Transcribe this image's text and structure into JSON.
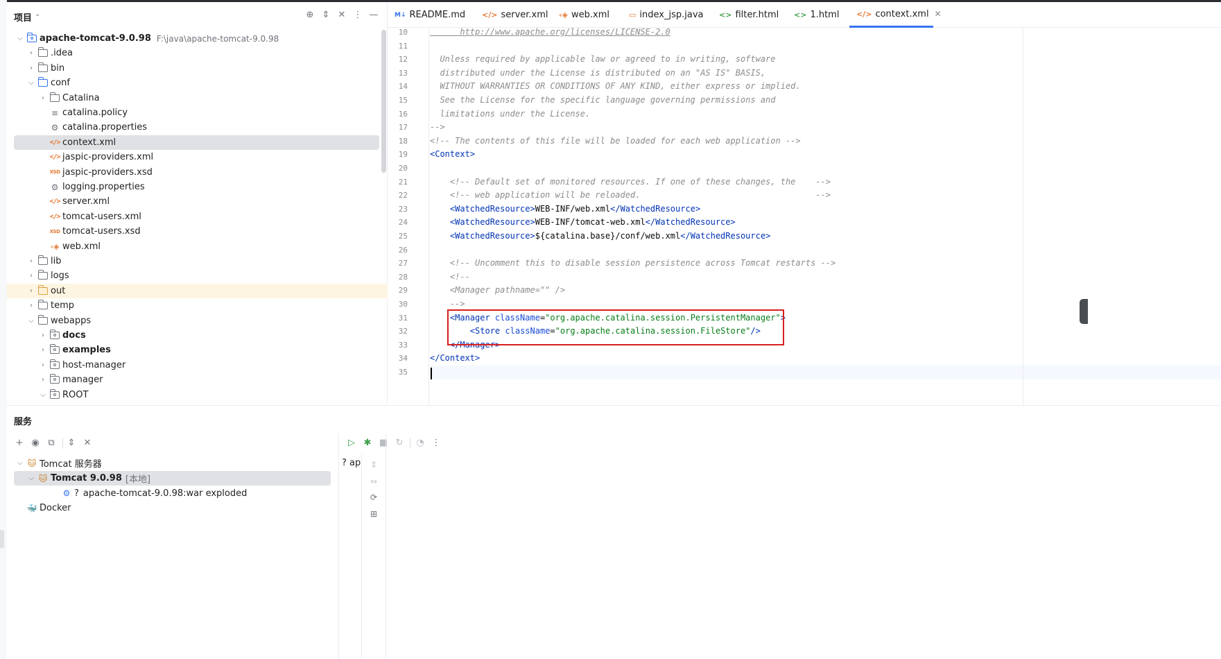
{
  "project": {
    "title": "项目",
    "tree": [
      {
        "label": "apache-tomcat-9.0.98",
        "path": "F:\\java\\apache-tomcat-9.0.98"
      },
      {
        "label": ".idea"
      },
      {
        "label": "bin"
      },
      {
        "label": "conf"
      },
      {
        "label": "Catalina"
      },
      {
        "label": "catalina.policy"
      },
      {
        "label": "catalina.properties"
      },
      {
        "label": "context.xml"
      },
      {
        "label": "jaspic-providers.xml"
      },
      {
        "label": "jaspic-providers.xsd"
      },
      {
        "label": "logging.properties"
      },
      {
        "label": "server.xml"
      },
      {
        "label": "tomcat-users.xml"
      },
      {
        "label": "tomcat-users.xsd"
      },
      {
        "label": "web.xml"
      },
      {
        "label": "lib"
      },
      {
        "label": "logs"
      },
      {
        "label": "out"
      },
      {
        "label": "temp"
      },
      {
        "label": "webapps"
      },
      {
        "label": "docs"
      },
      {
        "label": "examples"
      },
      {
        "label": "host-manager"
      },
      {
        "label": "manager"
      },
      {
        "label": "ROOT"
      }
    ]
  },
  "tabs": [
    {
      "label": "README.md",
      "icon": "M↓"
    },
    {
      "label": "server.xml",
      "icon": "</>"
    },
    {
      "label": "web.xml",
      "icon": "</>"
    },
    {
      "label": "index_jsp.java",
      "icon": "▭"
    },
    {
      "label": "filter.html",
      "icon": "<>"
    },
    {
      "label": "1.html",
      "icon": "<>"
    },
    {
      "label": "context.xml",
      "icon": "</>",
      "active": true
    }
  ],
  "editor": {
    "lines": [
      {
        "n": "10",
        "parts": [
          {
            "t": "      http://www.apache.org/licenses/LICENSE-2.0",
            "c": "cm link"
          }
        ]
      },
      {
        "n": "11",
        "parts": []
      },
      {
        "n": "12",
        "parts": [
          {
            "t": "  Unless required by applicable law or agreed to in writing, software",
            "c": "cm"
          }
        ]
      },
      {
        "n": "13",
        "parts": [
          {
            "t": "  distributed under the License is distributed on an \"AS IS\" BASIS,",
            "c": "cm"
          }
        ]
      },
      {
        "n": "14",
        "parts": [
          {
            "t": "  WITHOUT WARRANTIES OR CONDITIONS OF ANY KIND, either express or implied.",
            "c": "cm"
          }
        ]
      },
      {
        "n": "15",
        "parts": [
          {
            "t": "  See the License for the specific language governing permissions and",
            "c": "cm"
          }
        ]
      },
      {
        "n": "16",
        "parts": [
          {
            "t": "  limitations under the License.",
            "c": "cm"
          }
        ]
      },
      {
        "n": "17",
        "parts": [
          {
            "t": "-->",
            "c": "cm"
          }
        ]
      },
      {
        "n": "18",
        "parts": [
          {
            "t": "<!-- The contents of this file will be loaded for each web application -->",
            "c": "cm"
          }
        ]
      },
      {
        "n": "19",
        "parts": [
          {
            "t": "<",
            "c": "tg"
          },
          {
            "t": "Context",
            "c": "tg"
          },
          {
            "t": ">",
            "c": "tg"
          }
        ]
      },
      {
        "n": "20",
        "parts": []
      },
      {
        "n": "21",
        "parts": [
          {
            "t": "    <!-- Default set of monitored resources. If one of these changes, the    -->",
            "c": "cm"
          }
        ]
      },
      {
        "n": "22",
        "parts": [
          {
            "t": "    <!-- web application will be reloaded.                                   -->",
            "c": "cm"
          }
        ]
      },
      {
        "n": "23",
        "parts": [
          {
            "t": "    <",
            "c": "tg"
          },
          {
            "t": "WatchedResource",
            "c": "tg"
          },
          {
            "t": ">",
            "c": "tg"
          },
          {
            "t": "WEB-INF/web.xml",
            "c": "tx"
          },
          {
            "t": "</",
            "c": "tg"
          },
          {
            "t": "WatchedResource",
            "c": "tg"
          },
          {
            "t": ">",
            "c": "tg"
          }
        ]
      },
      {
        "n": "24",
        "parts": [
          {
            "t": "    <",
            "c": "tg"
          },
          {
            "t": "WatchedResource",
            "c": "tg"
          },
          {
            "t": ">",
            "c": "tg"
          },
          {
            "t": "WEB-INF/tomcat-web.xml",
            "c": "tx"
          },
          {
            "t": "</",
            "c": "tg"
          },
          {
            "t": "WatchedResource",
            "c": "tg"
          },
          {
            "t": ">",
            "c": "tg"
          }
        ]
      },
      {
        "n": "25",
        "parts": [
          {
            "t": "    <",
            "c": "tg"
          },
          {
            "t": "WatchedResource",
            "c": "tg"
          },
          {
            "t": ">",
            "c": "tg"
          },
          {
            "t": "${catalina.base}/conf/web.xml",
            "c": "tx"
          },
          {
            "t": "</",
            "c": "tg"
          },
          {
            "t": "WatchedResource",
            "c": "tg"
          },
          {
            "t": ">",
            "c": "tg"
          }
        ]
      },
      {
        "n": "26",
        "parts": []
      },
      {
        "n": "27",
        "parts": [
          {
            "t": "    <!-- Uncomment this to disable session persistence across Tomcat restarts -->",
            "c": "cm"
          }
        ]
      },
      {
        "n": "28",
        "parts": [
          {
            "t": "    <!--",
            "c": "cm"
          }
        ]
      },
      {
        "n": "29",
        "parts": [
          {
            "t": "    <Manager pathname=\"\" />",
            "c": "cm"
          }
        ]
      },
      {
        "n": "30",
        "parts": [
          {
            "t": "    -->",
            "c": "cm"
          }
        ]
      },
      {
        "n": "31",
        "parts": [
          {
            "t": "    <",
            "c": "tg"
          },
          {
            "t": "Manager ",
            "c": "tg"
          },
          {
            "t": "className",
            "c": "at"
          },
          {
            "t": "=",
            "c": "tx"
          },
          {
            "t": "\"org.apache.catalina.session.PersistentManager\"",
            "c": "av"
          },
          {
            "t": ">",
            "c": "tg"
          }
        ]
      },
      {
        "n": "32",
        "parts": [
          {
            "t": "        <",
            "c": "tg"
          },
          {
            "t": "Store ",
            "c": "tg"
          },
          {
            "t": "className",
            "c": "at"
          },
          {
            "t": "=",
            "c": "tx"
          },
          {
            "t": "\"org.apache.catalina.session.FileStore\"",
            "c": "av"
          },
          {
            "t": "/>",
            "c": "tg"
          }
        ]
      },
      {
        "n": "33",
        "parts": [
          {
            "t": "    </",
            "c": "tg"
          },
          {
            "t": "Manager",
            "c": "tg"
          },
          {
            "t": ">",
            "c": "tg"
          }
        ]
      },
      {
        "n": "34",
        "parts": [
          {
            "t": "</",
            "c": "tg"
          },
          {
            "t": "Context",
            "c": "tg"
          },
          {
            "t": ">",
            "c": "tg"
          }
        ]
      },
      {
        "n": "35",
        "parts": []
      }
    ]
  },
  "services": {
    "title": "服务",
    "tree": [
      {
        "label": "Tomcat 服务器"
      },
      {
        "label": "Tomcat 9.0.98",
        "local": "[本地]"
      },
      {
        "label": "apache-tomcat-9.0.98:war exploded",
        "prefix": "?"
      },
      {
        "label": "Docker"
      }
    ],
    "detail_text": "ap",
    "detail_prefix": "?"
  }
}
